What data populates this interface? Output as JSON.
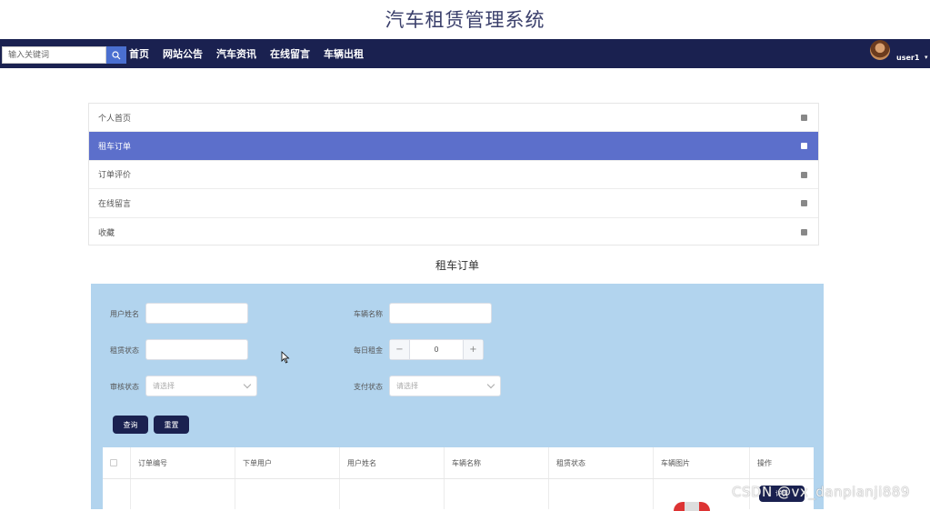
{
  "site": {
    "title": "汽车租赁管理系统"
  },
  "nav": {
    "search_placeholder": "输入关键词",
    "links": [
      "首页",
      "网站公告",
      "汽车资讯",
      "在线留言",
      "车辆出租"
    ],
    "username": "user1",
    "caret": "▾"
  },
  "side_menu": {
    "items": [
      "个人首页",
      "租车订单",
      "订单评价",
      "在线留言",
      "收藏"
    ],
    "active_index": 1
  },
  "section": {
    "title": "租车订单"
  },
  "filters": {
    "user_name_label": "用户姓名",
    "car_name_label": "车辆名称",
    "rent_status_label": "租赁状态",
    "daily_rent_label": "每日租金",
    "daily_rent_value": "0",
    "audit_status_label": "审核状态",
    "audit_status_placeholder": "请选择",
    "pay_status_label": "支付状态",
    "pay_status_placeholder": "请选择",
    "minus": "−",
    "plus": "+",
    "query_button": "查询",
    "reset_button": "重置"
  },
  "table": {
    "columns": [
      "订单编号",
      "下单用户",
      "用户姓名",
      "车辆名称",
      "租赁状态",
      "车辆图片",
      "操作"
    ],
    "row_action": "详情"
  },
  "watermark": "CSDN @vx_danpianji889",
  "colors": {
    "nav_bg": "#1a2150",
    "accent": "#5c6fcb",
    "panel_bg": "#b2d4ee"
  }
}
